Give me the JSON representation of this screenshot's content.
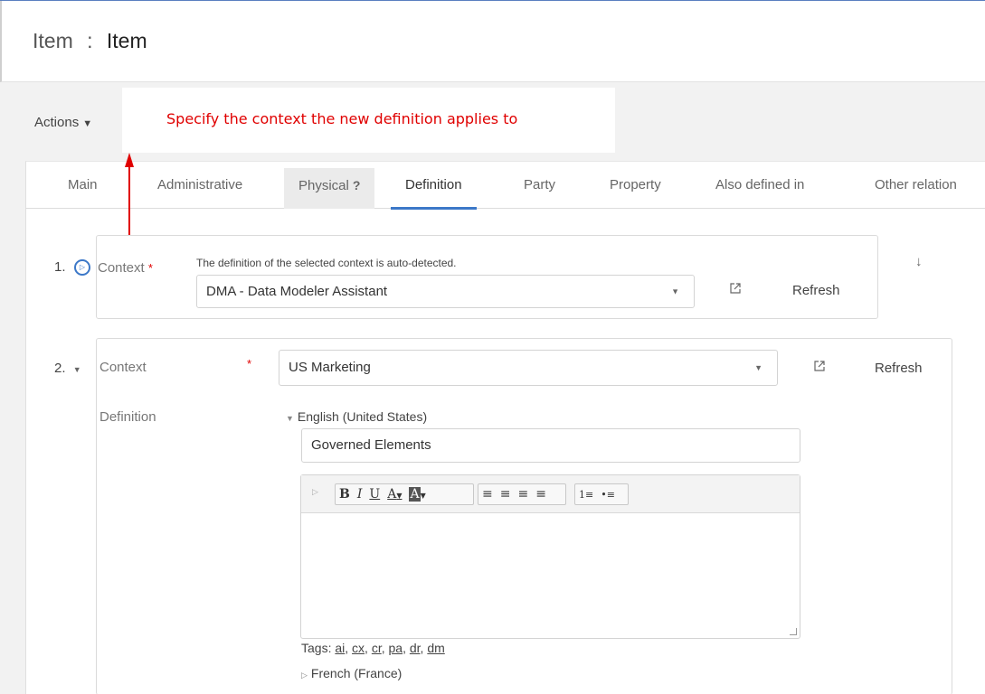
{
  "header": {
    "object_type": "Item",
    "separator": ":",
    "item_name": "Item"
  },
  "actions": {
    "label": "Actions",
    "caret": "▼"
  },
  "callout": {
    "text": "Specify the context the new definition applies to"
  },
  "tabs": [
    {
      "label": "Main"
    },
    {
      "label": "Administrative"
    },
    {
      "label": "Physical",
      "badge": "?"
    },
    {
      "label": "Definition"
    },
    {
      "label": "Party"
    },
    {
      "label": "Property"
    },
    {
      "label": "Also defined in"
    },
    {
      "label": "Other relation"
    }
  ],
  "active_tab": "Definition",
  "definition1": {
    "number": "1.",
    "context_label": "Context",
    "required_mark": "*",
    "hint": "The definition of the selected context is auto-detected.",
    "context_value": "DMA - Data Modeler Assistant",
    "refresh_label": "Refresh",
    "move_icon": "↓"
  },
  "definition2": {
    "number": "2.",
    "context_label": "Context",
    "required_mark": "*",
    "context_value": "US Marketing",
    "refresh_label": "Refresh",
    "definition_label": "Definition",
    "languages": [
      {
        "label": "English (United States)",
        "expanded": true
      },
      {
        "label": "French (France)",
        "expanded": false
      }
    ],
    "term_value": "Governed Elements",
    "toolbar": {
      "bold": "B",
      "italic": "I",
      "underline": "U",
      "font_color": "A",
      "bg_color": "A",
      "align_left": "≡",
      "align_center": "≡",
      "align_right": "≡",
      "justify": "≡",
      "ordered_list": "1≡",
      "bullet_list": "•≡"
    },
    "tags_label": "Tags:",
    "tags": [
      "ai",
      "cx",
      "cr",
      "pa",
      "dr",
      "dm"
    ]
  },
  "colors": {
    "accent": "#3c78c8",
    "callout_text": "#e00000",
    "required": "#e00000"
  },
  "icons": {
    "external_link": "external-link-icon",
    "caret": "chevron-down-icon",
    "expand": "expand-triangle-icon"
  }
}
